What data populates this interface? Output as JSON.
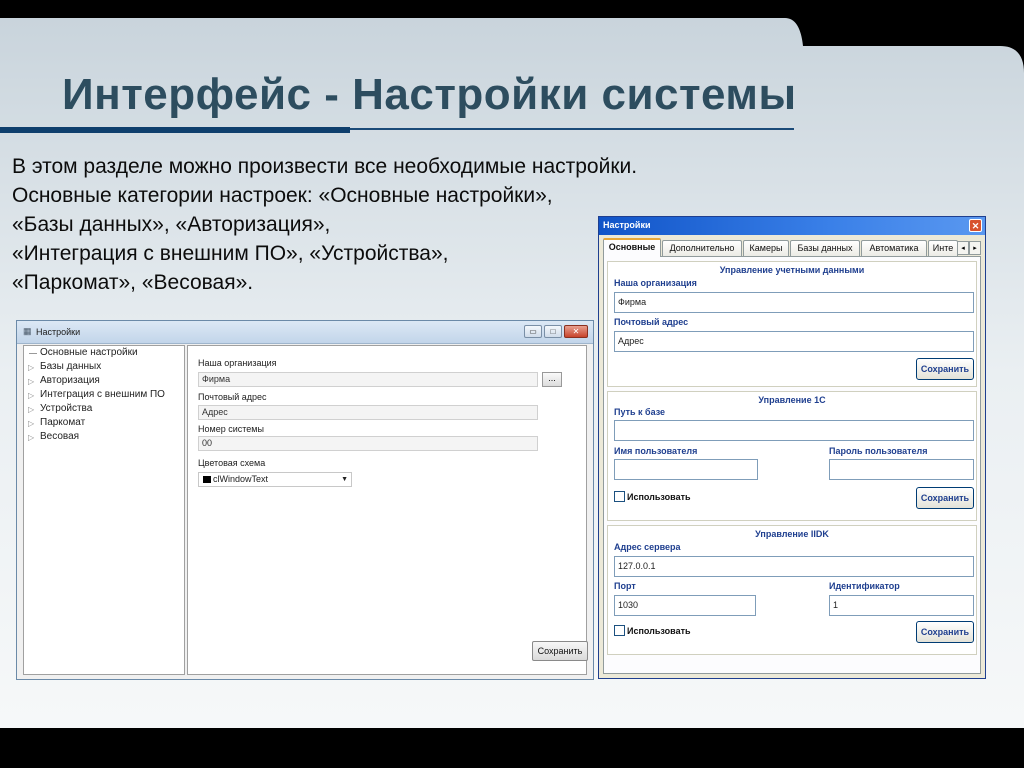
{
  "slide": {
    "title": "Интерфейс - Настройки системы",
    "lines": [
      "В этом разделе можно произвести все необходимые настройки.",
      "Основные категории настроек: «Основные настройки»,",
      "«Базы данных», «Авторизация»,",
      "«Интеграция с внешним ПО», «Устройства»,",
      "«Паркомат», «Весовая»."
    ]
  },
  "left_window": {
    "title": "Настройки",
    "tree": [
      "Основные настройки",
      "Базы данных",
      "Авторизация",
      "Интеграция с внешним ПО",
      "Устройства",
      "Паркомат",
      "Весовая"
    ],
    "fields": {
      "org_label": "Наша организация",
      "org_value": "Фирма",
      "dots": "...",
      "mail_label": "Почтовый адрес",
      "mail_value": "Адрес",
      "sysnum_label": "Номер системы",
      "sysnum_value": "00",
      "color_label": "Цветовая схема",
      "color_value": "clWindowText"
    },
    "save": "Сохранить",
    "controls": {
      "minimize": "▭",
      "maximize": "□",
      "close": "✕"
    }
  },
  "right_window": {
    "title": "Настройки",
    "close": "✕",
    "tabs": [
      "Основные",
      "Дополнительно",
      "Камеры",
      "Базы данных",
      "Автоматика",
      "Инте"
    ],
    "tab_prev": "◂",
    "tab_next": "▸",
    "accounts": {
      "title": "Управление учетными данными",
      "org_label": "Наша организация",
      "org_value": "Фирма",
      "mail_label": "Почтовый адрес",
      "mail_value": "Адрес",
      "save": "Сохранить"
    },
    "onec": {
      "title": "Управление 1С",
      "path_label": "Путь к базе",
      "path_value": "",
      "user_label": "Имя пользователя",
      "user_value": "",
      "pass_label": "Пароль пользователя",
      "pass_value": "",
      "use": "Использовать",
      "save": "Сохранить"
    },
    "iidk": {
      "title": "Управление IIDK",
      "server_label": "Адрес сервера",
      "server_value": "127.0.0.1",
      "port_label": "Порт",
      "port_value": "1030",
      "id_label": "Идентификатор",
      "id_value": "1",
      "use": "Использовать",
      "save": "Сохранить"
    }
  },
  "colors": {
    "title": "#2d4d5f",
    "rule": "#0f3f6d",
    "group_label": "#1f3f8f"
  }
}
